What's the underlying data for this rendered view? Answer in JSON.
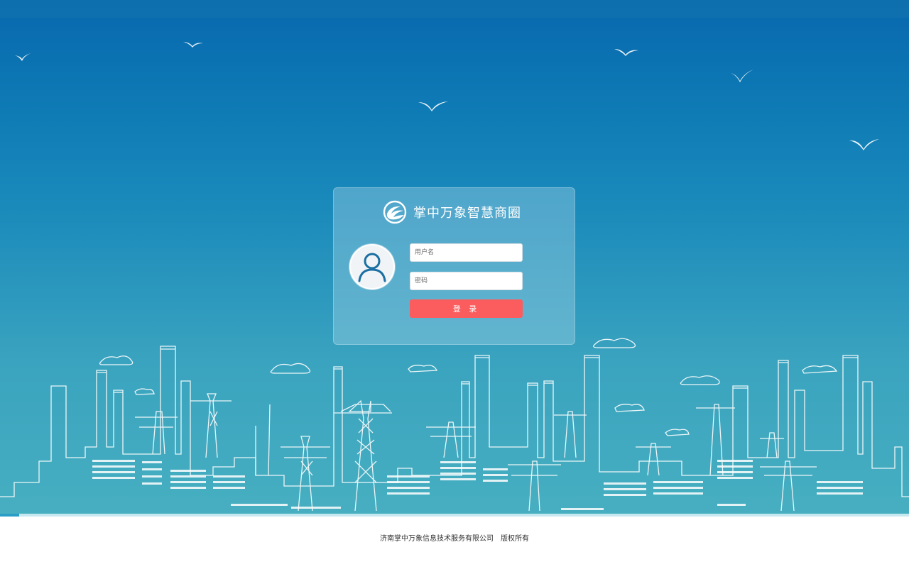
{
  "brand": {
    "name": "掌中万象智慧商圈",
    "logo_icon": "swirl-logo-icon"
  },
  "login": {
    "username_placeholder": "用户名",
    "password_placeholder": "密码",
    "submit_label": "登 录",
    "avatar_icon": "user-avatar-icon"
  },
  "footer": {
    "copyright": "济南掌中万象信息技术服务有限公司　版权所有"
  },
  "colors": {
    "sky_top": "#0868ae",
    "sky_bottom": "#47afc0",
    "button": "#fb5c5e",
    "avatar_stroke": "#1a6fa3"
  },
  "decorations": {
    "birds_icon": "bird-icon",
    "skyline": "city-skyline-with-power-towers"
  }
}
